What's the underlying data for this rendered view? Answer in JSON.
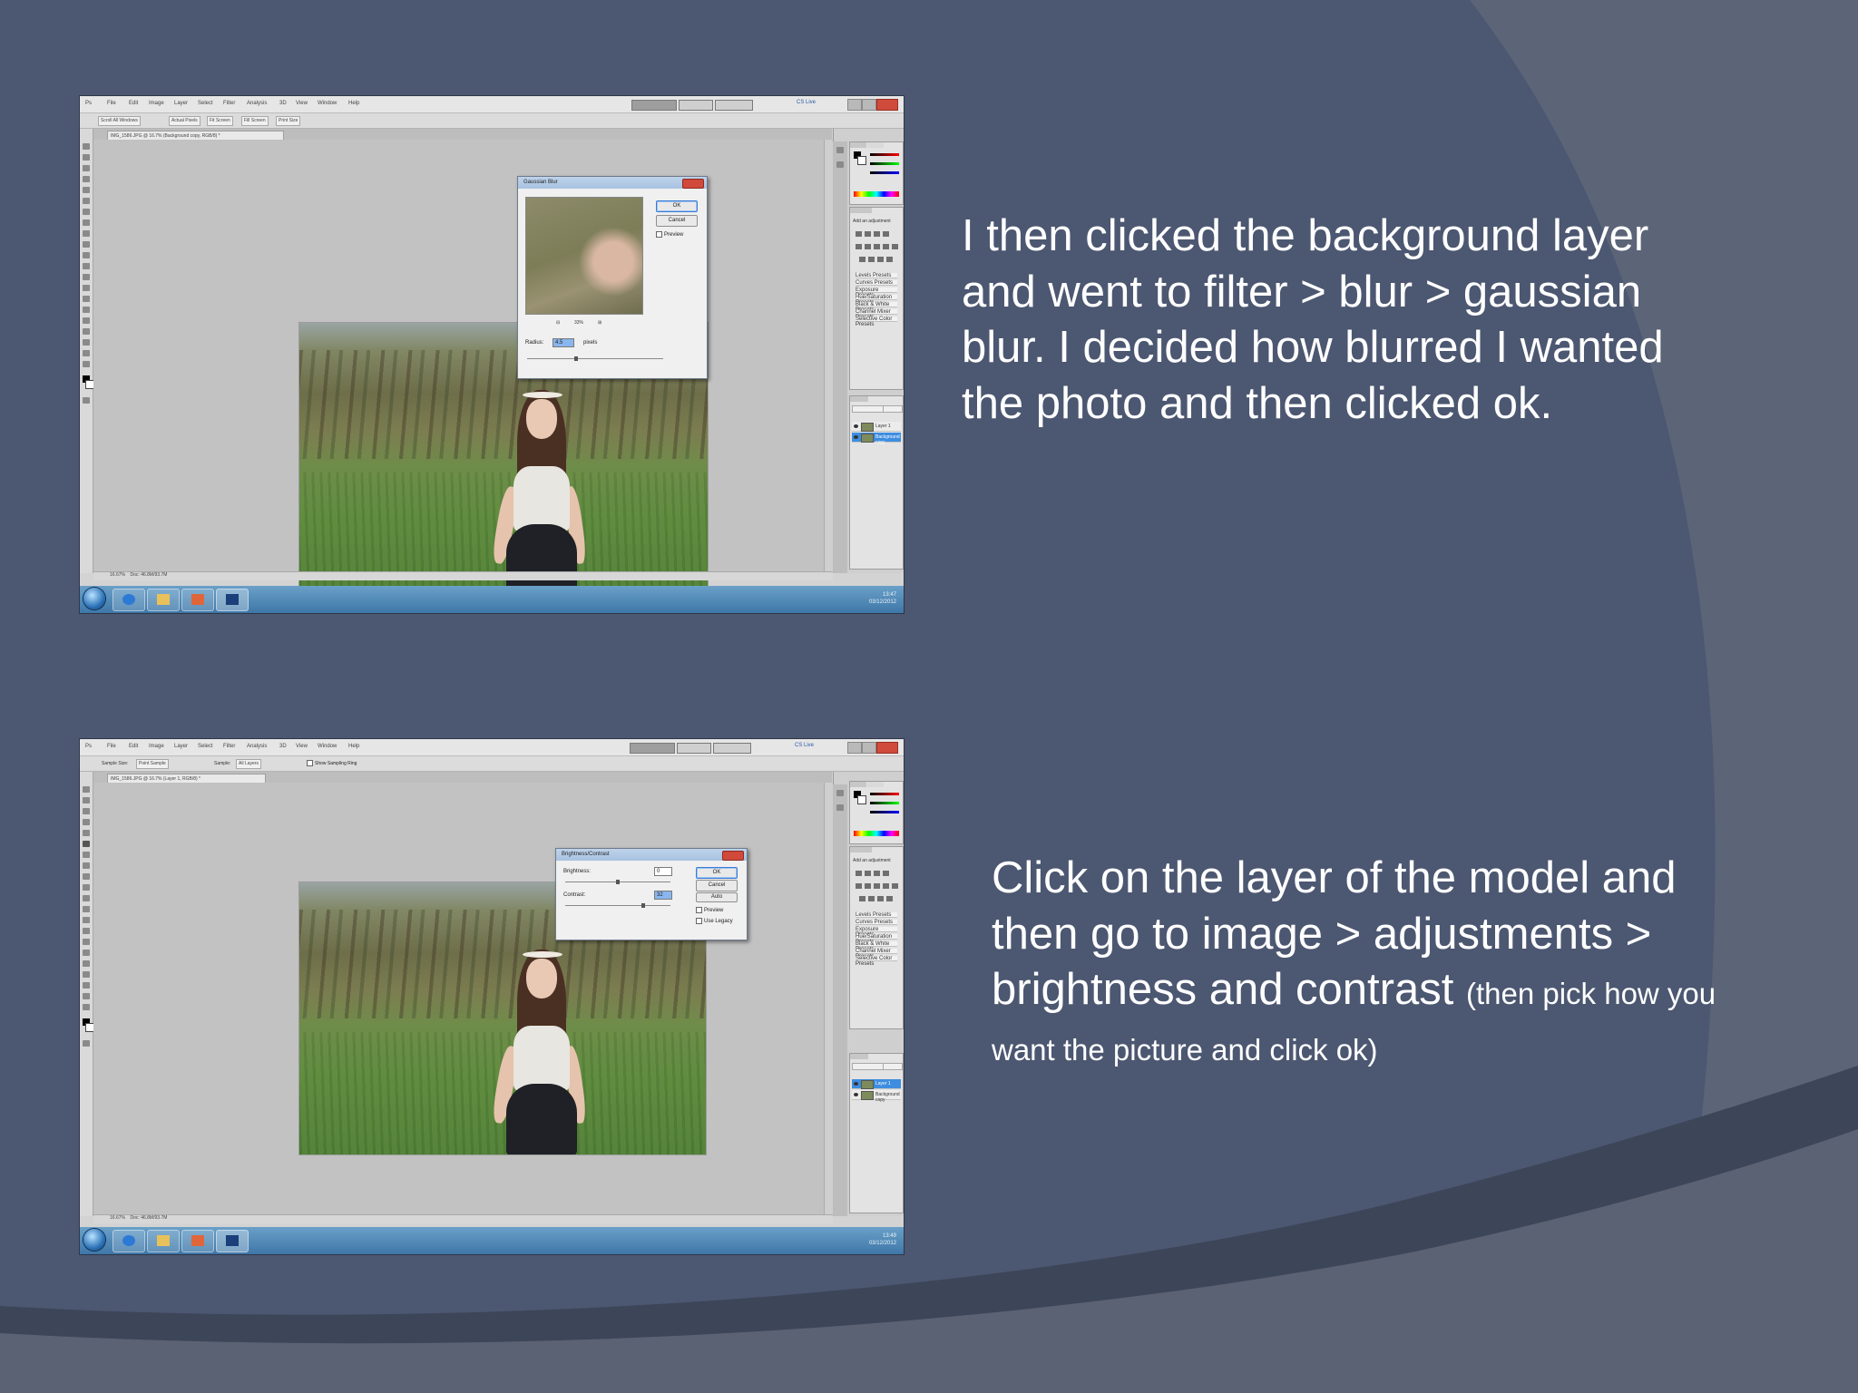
{
  "slide": {
    "caption_top": "I then clicked the background layer and went to filter > blur > gaussian blur. I decided how blurred I wanted the photo and then clicked ok.",
    "caption_bottom_main": "Click on the layer of the model and then go to image > adjustments > brightness and contrast",
    "caption_bottom_small": "(then pick how you want the picture and click ok)",
    "colors": {
      "background": "#4c5771",
      "swoosh_dark": "#3d4559",
      "swoosh_light": "#5c6478",
      "text": "#ffffff",
      "taskbar": "#3e77a8"
    }
  },
  "screenshots": [
    {
      "app": "Photoshop",
      "menu": [
        "File",
        "Edit",
        "Image",
        "Layer",
        "Select",
        "Filter",
        "Analysis",
        "3D",
        "View",
        "Window",
        "Help"
      ],
      "workspace_switcher": [
        "ESSENTIALS",
        "DESIGN",
        "PAINTING"
      ],
      "cs_live": "CS Live",
      "options": [
        "Scroll All Windows",
        "Actual Pixels",
        "Fit Screen",
        "Fill Screen",
        "Print Size"
      ],
      "document_tab": "IMG_1586.JPG @ 16.7% (Background copy, RGB/8) *",
      "zoom": "16.67%",
      "doc_info": "Doc: 46.8M/93.7M",
      "clock_time": "13:47",
      "clock_date": "03/12/2012",
      "dialog": {
        "title": "Gaussian Blur",
        "ok": "OK",
        "cancel": "Cancel",
        "preview": "Preview",
        "zoom": "33%",
        "radius_label": "Radius:",
        "radius_value": "4.5",
        "radius_unit": "pixels"
      },
      "adjustments_title": "Add an adjustment",
      "presets": [
        "Levels Presets",
        "Curves Presets",
        "Exposure Presets",
        "Hue/Saturation Presets",
        "Black & White Presets",
        "Channel Mixer Presets",
        "Selective Color Presets"
      ],
      "layers": [
        {
          "name": "Layer 1",
          "selected": false
        },
        {
          "name": "Background copy",
          "selected": true
        }
      ],
      "icons": [
        "photoshop-icon",
        "explorer-icon",
        "folder-icon",
        "media-icon",
        "ps-icon"
      ]
    },
    {
      "app": "Photoshop",
      "menu": [
        "File",
        "Edit",
        "Image",
        "Layer",
        "Select",
        "Filter",
        "Analysis",
        "3D",
        "View",
        "Window",
        "Help"
      ],
      "workspace_switcher": [
        "ESSENTIALS",
        "DESIGN",
        "PAINTING"
      ],
      "cs_live": "CS Live",
      "options": [
        "Sample Size:",
        "Point Sample",
        "Sample:",
        "All Layers",
        "Show Sampling Ring"
      ],
      "document_tab": "IMG_1586.JPG @ 16.7% (Layer 1, RGB/8) *",
      "zoom": "16.67%",
      "doc_info": "Doc: 46.8M/93.7M",
      "clock_time": "13:49",
      "clock_date": "03/12/2012",
      "dialog": {
        "title": "Brightness/Contrast",
        "ok": "OK",
        "cancel": "Cancel",
        "preview": "Preview",
        "use_legacy": "Use Legacy",
        "auto": "Auto",
        "brightness_label": "Brightness:",
        "brightness_value": "0",
        "contrast_label": "Contrast:",
        "contrast_value": "32"
      },
      "adjustments_title": "Add an adjustment",
      "presets": [
        "Levels Presets",
        "Curves Presets",
        "Exposure Presets",
        "Hue/Saturation Presets",
        "Black & White Presets",
        "Channel Mixer Presets",
        "Selective Color Presets"
      ],
      "layers": [
        {
          "name": "Layer 1",
          "selected": true
        },
        {
          "name": "Background copy",
          "selected": false
        }
      ],
      "icons": [
        "photoshop-icon",
        "explorer-icon",
        "folder-icon",
        "media-icon",
        "ps-icon"
      ]
    }
  ]
}
